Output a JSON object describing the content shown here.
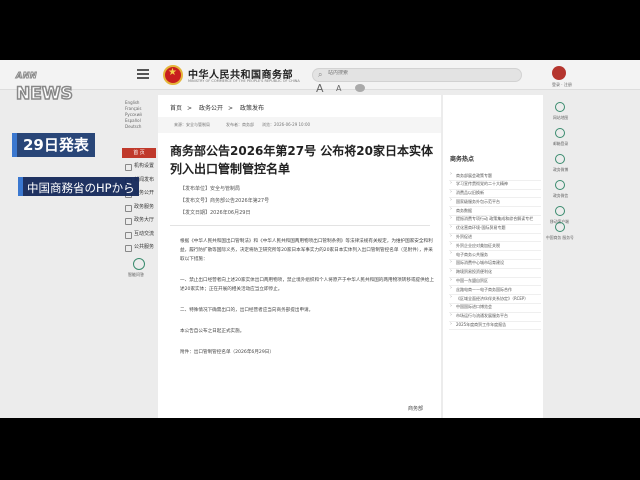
{
  "overlay": {
    "logo_top": "ANN",
    "logo_bottom": "NEWS",
    "caption_1": "29日発表",
    "caption_2": "中国商務省のHPから"
  },
  "header": {
    "site_name": "中华人民共和国商务部",
    "site_name_en": "MINISTRY OF COMMERCE OF THE PEOPLE'S REPUBLIC OF CHINA",
    "search_placeholder": "站内搜索",
    "login": "登录 · 注册"
  },
  "languages": [
    "English",
    "Français",
    "Русский",
    "Español",
    "Deutsch"
  ],
  "sidebar": {
    "home": "首 页",
    "items": [
      "机构设置",
      "新闻发布",
      "政务公开",
      "政务服务",
      "政务大厅",
      "互动交流",
      "公共服务"
    ],
    "smart_label": "智能问答"
  },
  "breadcrumb": [
    "首页",
    "政务公开",
    "政策发布"
  ],
  "meta": {
    "source_line": "来源：安全与管制局　　　　发布者：商务部　　浏览：2026-06-29 10:00"
  },
  "article": {
    "title": "商务部公告2026年第27号 公布将20家日本实体列入出口管制管控名单",
    "info": [
      "【发布单位】安全与管制局",
      "【发布文号】商务部公告2026年第27号",
      "【发文日期】2026年06月29日"
    ],
    "body_1": "根据《中华人民共和国出口管制法》和《中华人民共和国两用物项出口管制条例》等法律法规有关规定，为维护国家安全和利益，履行防扩散等国际义务，决定将防卫研究所等20家日本军事实力的20家日本实体列入出口管制管控名单（见附件），并采取以下措施：",
    "body_2": "一、禁止出口经营者向上述20家实体出口两用物项，禁止境外组织和个人将原产于中华人民共和国的两用物项转移或提供给上述20家实体；正在开展的相关活动应当立即停止。",
    "body_3": "二、特殊情况下确需出口的，出口经营者应当向商务部提出申请。",
    "body_4": "本公告自公布之日起正式实施。",
    "attachment": "附件：出口管制管控名单（2026年6月29日）",
    "sign": "商务部"
  },
  "hot_topics": {
    "title": "商务热点",
    "items": [
      "商务部展会政策专题",
      "学习宣传贯彻党的二十大精神",
      "消费品以旧换新",
      "国家级服务外包示范平台",
      "商务数据",
      "提振消费专项行动 政策集成和综合解读专栏",
      "优化营商环境-国际贸易专题",
      "外贸促进",
      "外贸企业应对美加征关税",
      "电子商务公共服务",
      "国际消费中心城市培育建设",
      "跨境贸易投资便利化",
      "中国一东盟自贸区",
      "丝路电商——电子商务国际合作",
      "《区域全面经济伙伴关系协定》（RCEP）",
      "中国国际进口博览会",
      "市场运行与流通发展服务平台",
      "2025年度商贸工作年度报告"
    ]
  },
  "right_links": [
    "网站地图",
    "邮箱登录",
    "政务微博",
    "政务微信",
    "移动客户端",
    "中国商务 服务号"
  ]
}
